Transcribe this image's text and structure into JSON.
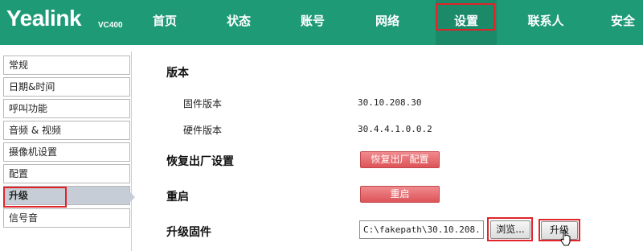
{
  "header": {
    "logo": "Yealink",
    "model": "VC400",
    "bg_color": "#1f9a76",
    "nav": [
      "首页",
      "状态",
      "账号",
      "网络",
      "设置",
      "联系人",
      "安全"
    ],
    "active_nav": "设置"
  },
  "sidebar": {
    "items": [
      "常规",
      "日期&时间",
      "呼叫功能",
      "音频 & 视频",
      "摄像机设置",
      "配置",
      "升级",
      "信号音"
    ],
    "active_item": "升级"
  },
  "main": {
    "version_title": "版本",
    "firmware_version_label": "固件版本",
    "firmware_version_value": "30.10.208.30",
    "hardware_version_label": "硬件版本",
    "hardware_version_value": "30.4.4.1.0.0.2",
    "factory_reset_title": "恢复出厂设置",
    "factory_reset_button": "恢复出厂配置",
    "reboot_title": "重启",
    "reboot_button": "重启",
    "upgrade_title": "升级固件",
    "file_path_value": "C:\\fakepath\\30.10.208.",
    "browse_button": "浏览...",
    "upgrade_button": "升级",
    "accent_red": "#e0242a"
  }
}
